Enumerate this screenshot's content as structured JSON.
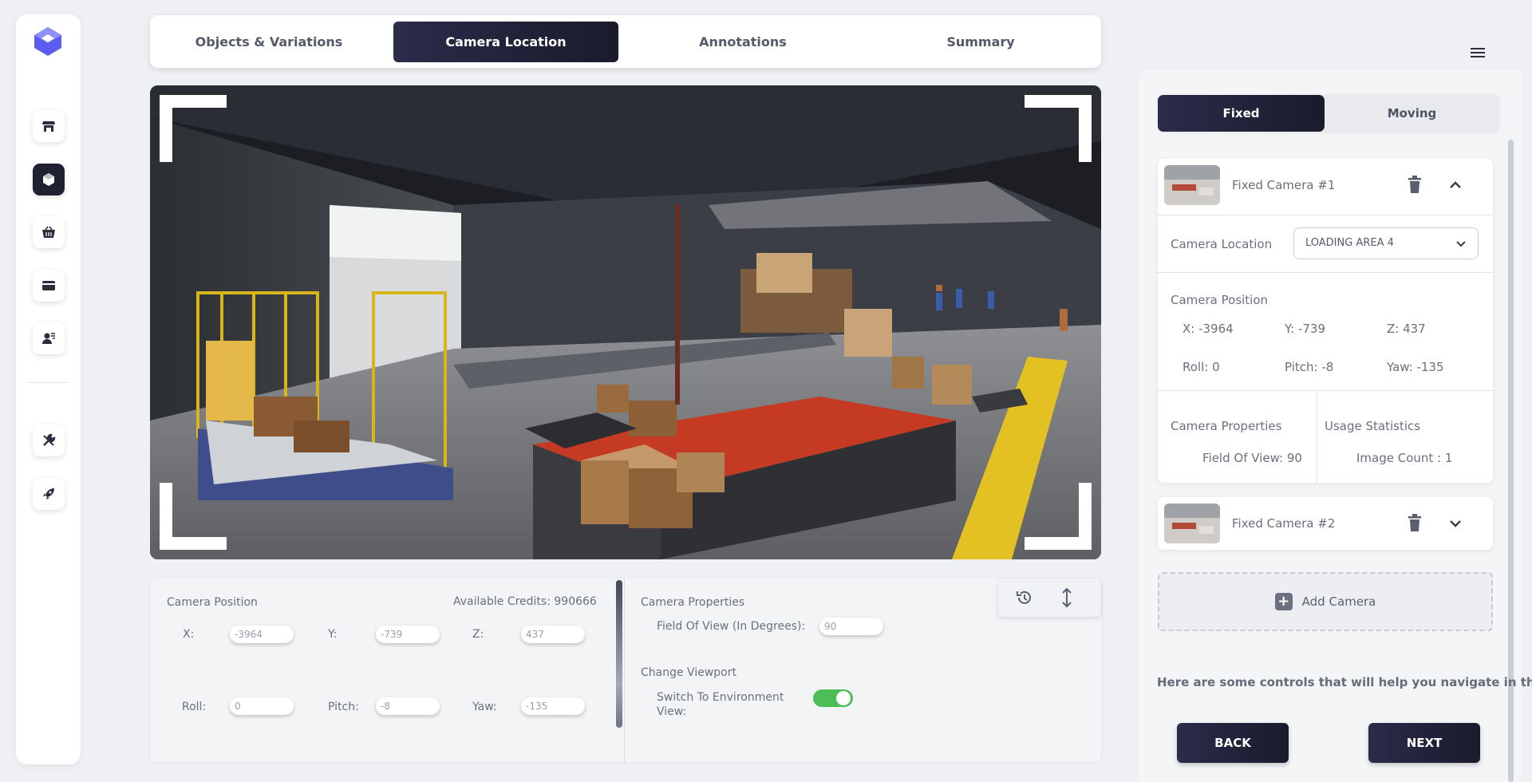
{
  "nav": {
    "logo": "logo-mark",
    "items": [
      "store-icon",
      "cube-icon",
      "basket-icon",
      "card-icon",
      "user-settings-icon",
      "tools-icon",
      "rocket-icon"
    ],
    "active": "cube-icon"
  },
  "tabs": [
    "Objects & Variations",
    "Camera Location",
    "Annotations",
    "Summary"
  ],
  "active_tab": "Camera Location",
  "viewport": {
    "scene": "warehouse loading area 3D view"
  },
  "bottom": {
    "position_title": "Camera Position",
    "credits": "Available Credits: 990666",
    "x_label": "X:",
    "x": "-3964",
    "y_label": "Y:",
    "y": "-739",
    "z_label": "Z:",
    "z": "437",
    "roll_label": "Roll:",
    "roll": "0",
    "pitch_label": "Pitch:",
    "pitch": "-8",
    "yaw_label": "Yaw:",
    "yaw": "-135",
    "props_title": "Camera Properties",
    "fov_label": "Field Of View (In Degrees):",
    "fov": "90",
    "viewport_title": "Change Viewport",
    "switch_label": "Switch To Environment View:",
    "switch_on": true
  },
  "right": {
    "seg_fixed": "Fixed",
    "seg_moving": "Moving",
    "cam1": {
      "title": "Fixed Camera #1",
      "location_label": "Camera Location",
      "location_value": "LOADING AREA 4",
      "position_title": "Camera Position",
      "x": "X: -3964",
      "y": "Y: -739",
      "z": "Z: 437",
      "roll": "Roll: 0",
      "pitch": "Pitch: -8",
      "yaw": "Yaw: -135",
      "props_title": "Camera Properties",
      "fov": "Field Of View: 90",
      "usage_title": "Usage Statistics",
      "image_count": "Image Count : 1"
    },
    "cam2": {
      "title": "Fixed Camera #2"
    },
    "add_camera": "Add Camera",
    "help_text": "Here are some controls that will help you navigate in the",
    "back": "BACK",
    "next": "NEXT"
  },
  "colors": {
    "accent_dark": "#1f2032",
    "toggle_on": "#4dbd58",
    "brand": "#5b5cf0"
  }
}
